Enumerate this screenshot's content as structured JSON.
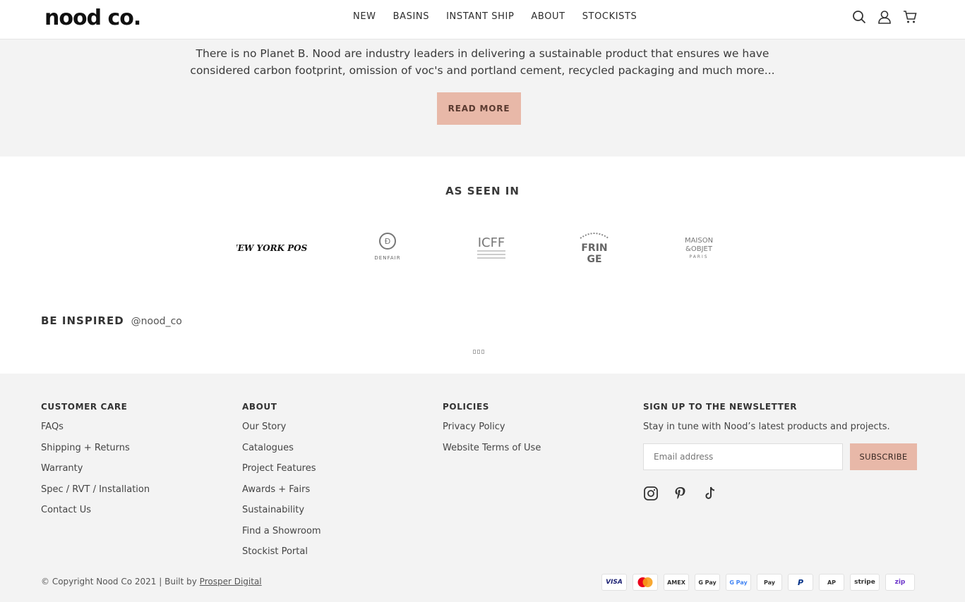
{
  "header": {
    "logo": "nood co.",
    "nav": [
      "NEW",
      "BASINS",
      "INSTANT SHIP",
      "ABOUT",
      "STOCKISTS"
    ],
    "icons": [
      "search-icon",
      "user-icon",
      "cart-icon"
    ]
  },
  "hero": {
    "line1": "There is no Planet B. Nood are industry leaders in delivering a sustainable product that ensures we have",
    "line2": "considered carbon footprint, omission of voc's and portland cement, recycled packaging and much more...",
    "button": "READ MORE"
  },
  "seen": {
    "title": "AS SEEN IN",
    "logos": [
      "NEW YORK POST",
      "DENFAIR",
      "ICFF",
      "MELBOURNE FRINGE",
      "MAISON&OBJET PARIS"
    ]
  },
  "inspired": {
    "title": "BE INSPIRED",
    "handle": "@nood_co"
  },
  "footer": {
    "customer_care": {
      "title": "CUSTOMER CARE",
      "links": [
        "FAQs",
        "Shipping + Returns",
        "Warranty",
        "Spec / RVT / Installation",
        "Contact Us"
      ]
    },
    "about": {
      "title": "ABOUT",
      "links": [
        "Our Story",
        "Catalogues",
        "Project Features",
        "Awards + Fairs",
        "Sustainability",
        "Find a Showroom",
        "Stockist Portal"
      ]
    },
    "policies": {
      "title": "POLICIES",
      "links": [
        "Privacy Policy",
        "Website Terms of Use"
      ]
    },
    "newsletter": {
      "title": "SIGN UP TO THE NEWSLETTER",
      "text": "Stay in tune with Nood’s latest products and projects.",
      "placeholder": "Email address",
      "button": "SUBSCRIBE",
      "socials": [
        "instagram-icon",
        "pinterest-icon",
        "tiktok-icon"
      ]
    },
    "copyright": "© Copyright Nood Co 2021 | Built by ",
    "builder": "Prosper Digital",
    "payments": [
      "VISA",
      "MC",
      "AMEX",
      "G Pay",
      "G Pay",
      "Pay",
      "P",
      "AP",
      "stripe",
      "zip"
    ]
  }
}
